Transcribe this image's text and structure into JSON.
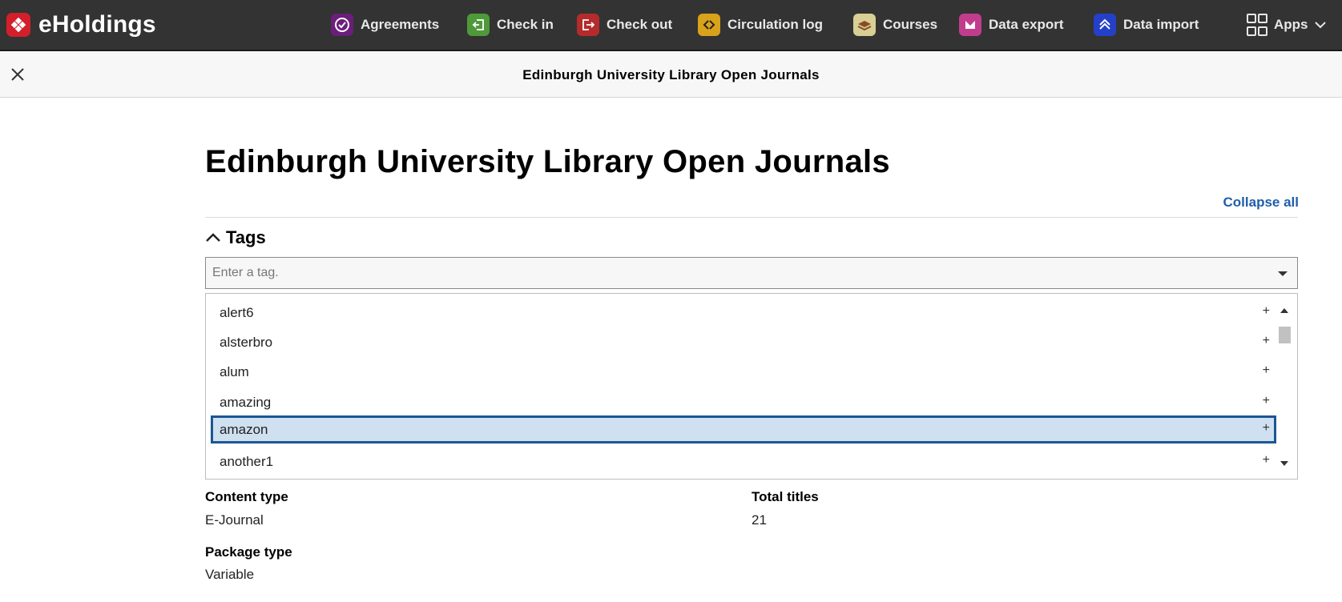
{
  "app": {
    "brand": "eHoldings",
    "nav": [
      {
        "label": "Agreements",
        "icon": "agreements-icon",
        "color": "#6b1e7a"
      },
      {
        "label": "Check in",
        "icon": "check-in-icon",
        "color": "#4e9a3a"
      },
      {
        "label": "Check out",
        "icon": "check-out-icon",
        "color": "#b52b2b"
      },
      {
        "label": "Circulation log",
        "icon": "circulation-log-icon",
        "color": "#d9a21b"
      },
      {
        "label": "Courses",
        "icon": "courses-icon",
        "color": "#d8cf94"
      },
      {
        "label": "Data export",
        "icon": "data-export-icon",
        "color": "#c23c8e"
      },
      {
        "label": "Data import",
        "icon": "data-import-icon",
        "color": "#2540c8"
      }
    ],
    "apps_label": "Apps"
  },
  "pane": {
    "header_title": "Edinburgh University Library Open Journals",
    "record_title": "Edinburgh University Library Open Journals",
    "collapse_all": "Collapse all"
  },
  "tags": {
    "section_title": "Tags",
    "placeholder": "Enter a tag.",
    "options": [
      "alert6",
      "alsterbro",
      "alum",
      "amazing",
      "amazon",
      "another1"
    ],
    "active_option": "amazon",
    "add_symbol": "+"
  },
  "fields": {
    "content_type": {
      "label": "Content type",
      "value": "E-Journal"
    },
    "total_titles": {
      "label": "Total titles",
      "value": "21"
    },
    "package_type": {
      "label": "Package type",
      "value": "Variable"
    }
  },
  "colors": {
    "topbar": "#333333",
    "brand_logo": "#d21f2b",
    "link": "#1f5ea8",
    "active_option_bg": "#cfe0f0",
    "active_option_border": "#1b5694"
  }
}
